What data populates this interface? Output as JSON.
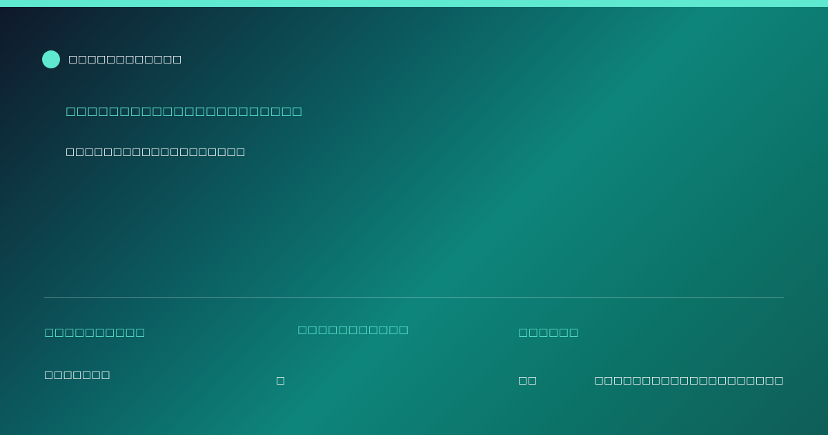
{
  "brand": {
    "name": "□□□□□□□□□□□□",
    "accent_color": "#5ee9d0"
  },
  "headline": "□□□□□□□□□□□□□□□□□□□□□□",
  "subline": "□□□□□□□□□□□□□□□□□□□",
  "footer": {
    "labels": [
      "□□□□□□□□□□",
      "□□□□□□□□□□□",
      "□□□□□□"
    ],
    "values": [
      "□□□□□□□",
      "□",
      "□□",
      "□□□□□□□□□□□□□□□□□□□□"
    ]
  }
}
